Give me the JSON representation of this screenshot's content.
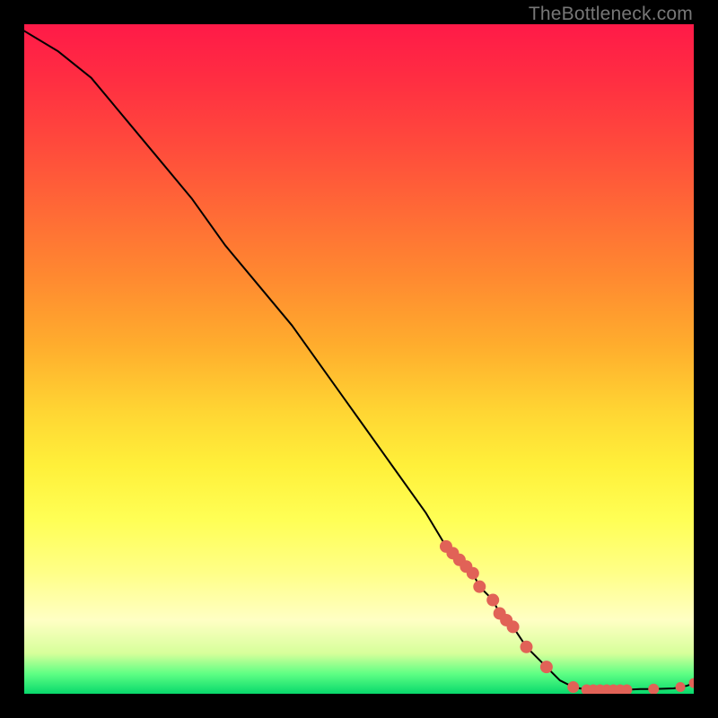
{
  "attribution": "TheBottleneck.com",
  "chart_data": {
    "type": "line",
    "title": "",
    "xlabel": "",
    "ylabel": "",
    "xlim": [
      0,
      100
    ],
    "ylim": [
      0,
      100
    ],
    "series": [
      {
        "name": "bottleneck-curve",
        "x": [
          0,
          5,
          10,
          15,
          20,
          25,
          30,
          35,
          40,
          45,
          50,
          55,
          60,
          63,
          64,
          65,
          66,
          67,
          68,
          70,
          71,
          72,
          73,
          75,
          78,
          80,
          82,
          84,
          85,
          86,
          87,
          88,
          89,
          90,
          92,
          94,
          97,
          98,
          99,
          100
        ],
        "y": [
          99,
          96,
          92,
          86,
          80,
          74,
          67,
          61,
          55,
          48,
          41,
          34,
          27,
          22,
          21,
          20,
          19,
          18,
          16,
          14,
          12,
          11,
          10,
          7,
          4,
          2,
          1,
          0.6,
          0.6,
          0.6,
          0.6,
          0.6,
          0.6,
          0.6,
          0.7,
          0.7,
          0.8,
          1.0,
          1.2,
          1.6
        ]
      }
    ],
    "markers": [
      {
        "x": 63,
        "y": 22,
        "r": 6.5
      },
      {
        "x": 64,
        "y": 21,
        "r": 6.5
      },
      {
        "x": 65,
        "y": 20,
        "r": 6.5
      },
      {
        "x": 66,
        "y": 19,
        "r": 6.5
      },
      {
        "x": 67,
        "y": 18,
        "r": 6.5
      },
      {
        "x": 68,
        "y": 16,
        "r": 6.5
      },
      {
        "x": 70,
        "y": 14,
        "r": 6.5
      },
      {
        "x": 71,
        "y": 12,
        "r": 6.5
      },
      {
        "x": 72,
        "y": 11,
        "r": 6.5
      },
      {
        "x": 73,
        "y": 10,
        "r": 6.5
      },
      {
        "x": 75,
        "y": 7,
        "r": 6.5
      },
      {
        "x": 78,
        "y": 4,
        "r": 6.5
      },
      {
        "x": 82,
        "y": 1,
        "r": 6.0
      },
      {
        "x": 84,
        "y": 0.6,
        "r": 5.5
      },
      {
        "x": 85,
        "y": 0.6,
        "r": 5.5
      },
      {
        "x": 86,
        "y": 0.6,
        "r": 5.5
      },
      {
        "x": 87,
        "y": 0.6,
        "r": 5.5
      },
      {
        "x": 88,
        "y": 0.6,
        "r": 5.5
      },
      {
        "x": 89,
        "y": 0.6,
        "r": 5.5
      },
      {
        "x": 90,
        "y": 0.6,
        "r": 5.5
      },
      {
        "x": 94,
        "y": 0.7,
        "r": 5.5
      },
      {
        "x": 98,
        "y": 1.0,
        "r": 5.0
      },
      {
        "x": 100,
        "y": 1.6,
        "r": 5.0
      }
    ],
    "style": {
      "line_color": "#000000",
      "line_width": 2,
      "marker_fill": "#e16257",
      "marker_stroke": "#e16257"
    }
  }
}
